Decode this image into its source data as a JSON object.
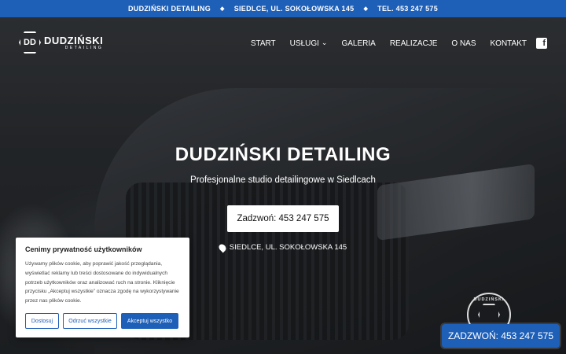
{
  "topbar": {
    "company": "DUDZIŃSKI DETAILING",
    "separator": "◆",
    "address": "SIEDLCE, UL. SOKOŁOWSKA 145",
    "phone": "TEL. 453 247 575"
  },
  "logo": {
    "brand": "DUDZIŃSKI",
    "sub": "DETAILING",
    "mark": "DD"
  },
  "nav": {
    "items": [
      {
        "label": "START"
      },
      {
        "label": "USŁUGI",
        "has_dropdown": true
      },
      {
        "label": "GALERIA"
      },
      {
        "label": "REALIZACJE"
      },
      {
        "label": "O NAS"
      },
      {
        "label": "KONTAKT"
      }
    ],
    "chevron": "⌄",
    "social_icon": "facebook-icon",
    "social_glyph": "f"
  },
  "hero": {
    "title": "DUDZIŃSKI DETAILING",
    "subtitle": "Profesjonalne studio detailingowe w Siedlcach",
    "call_label": "Zadzwoń: 453 247 575",
    "address": "SIEDLCE, UL. SOKOŁOWSKA 145",
    "address_icon": "map-pin-icon"
  },
  "badge": {
    "text": "DUDZIŃSKI"
  },
  "floating_call": {
    "label": "ZADZWOŃ: 453 247 575"
  },
  "cookie": {
    "title": "Cenimy prywatność użytkowników",
    "body": "Używamy plików cookie, aby poprawić jakość przeglądania, wyświetlać reklamy lub treści dostosowane do indywidualnych potrzeb użytkowników oraz analizować ruch na stronie. Kliknięcie przycisku „Akceptuj wszystkie” oznacza zgodę na wykorzystywanie przez nas plików cookie.",
    "customize": "Dostosuj",
    "reject": "Odrzuć wszystkie",
    "accept": "Akceptuj wszystko"
  },
  "colors": {
    "brand_blue": "#1e5fb8",
    "white": "#ffffff"
  }
}
